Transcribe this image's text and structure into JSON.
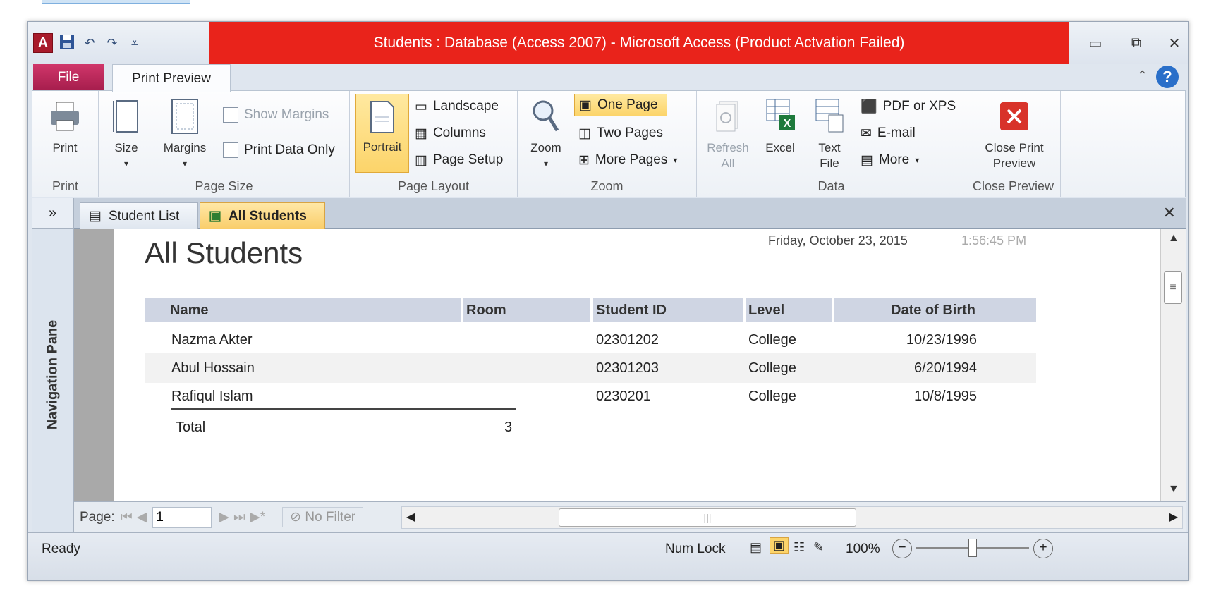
{
  "window": {
    "title": "Students : Database (Access 2007)  -  Microsoft Access (Product Actvation Failed)"
  },
  "tabs": {
    "file": "File",
    "print_preview": "Print Preview"
  },
  "ribbon": {
    "print_group": {
      "print": "Print",
      "label": "Print"
    },
    "page_size_group": {
      "size": "Size",
      "margins": "Margins",
      "show_margins": "Show Margins",
      "print_data_only": "Print Data Only",
      "label": "Page Size"
    },
    "page_layout_group": {
      "portrait": "Portrait",
      "landscape": "Landscape",
      "columns": "Columns",
      "page_setup": "Page Setup",
      "label": "Page Layout"
    },
    "zoom_group": {
      "zoom": "Zoom",
      "one_page": "One Page",
      "two_pages": "Two Pages",
      "more_pages": "More Pages",
      "label": "Zoom"
    },
    "data_group": {
      "refresh_all_1": "Refresh",
      "refresh_all_2": "All",
      "excel": "Excel",
      "text_file_1": "Text",
      "text_file_2": "File",
      "pdf_xps": "PDF or XPS",
      "email": "E-mail",
      "more": "More",
      "label": "Data"
    },
    "close_group": {
      "close_1": "Close Print",
      "close_2": "Preview",
      "label": "Close Preview"
    }
  },
  "nav": {
    "chevron": "»",
    "label": "Navigation Pane"
  },
  "doc_tabs": [
    {
      "label": "Student List"
    },
    {
      "label": "All Students"
    }
  ],
  "report": {
    "title": "All Students",
    "date": "Friday, October 23, 2015",
    "time": "1:56:45 PM",
    "headers": {
      "name": "Name",
      "room": "Room",
      "student_id": "Student ID",
      "level": "Level",
      "dob": "Date of Birth"
    },
    "rows": [
      {
        "name": "Nazma Akter",
        "room": "",
        "student_id": "02301202",
        "level": "College",
        "dob": "10/23/1996"
      },
      {
        "name": "Abul Hossain",
        "room": "",
        "student_id": "02301203",
        "level": "College",
        "dob": "6/20/1994"
      },
      {
        "name": "Rafiqul Islam",
        "room": "",
        "student_id": "0230201",
        "level": "College",
        "dob": "10/8/1995"
      }
    ],
    "total_label": "Total",
    "total_value": "3"
  },
  "pagebar": {
    "label": "Page:",
    "value": "1",
    "filter": "No Filter"
  },
  "status": {
    "ready": "Ready",
    "numlock": "Num Lock",
    "zoom": "100%"
  },
  "colors": {
    "title_bar": "#e9231b",
    "file_tab": "#c0285c",
    "selected": "#fcd46a",
    "header_fill": "#cfd5e3"
  }
}
